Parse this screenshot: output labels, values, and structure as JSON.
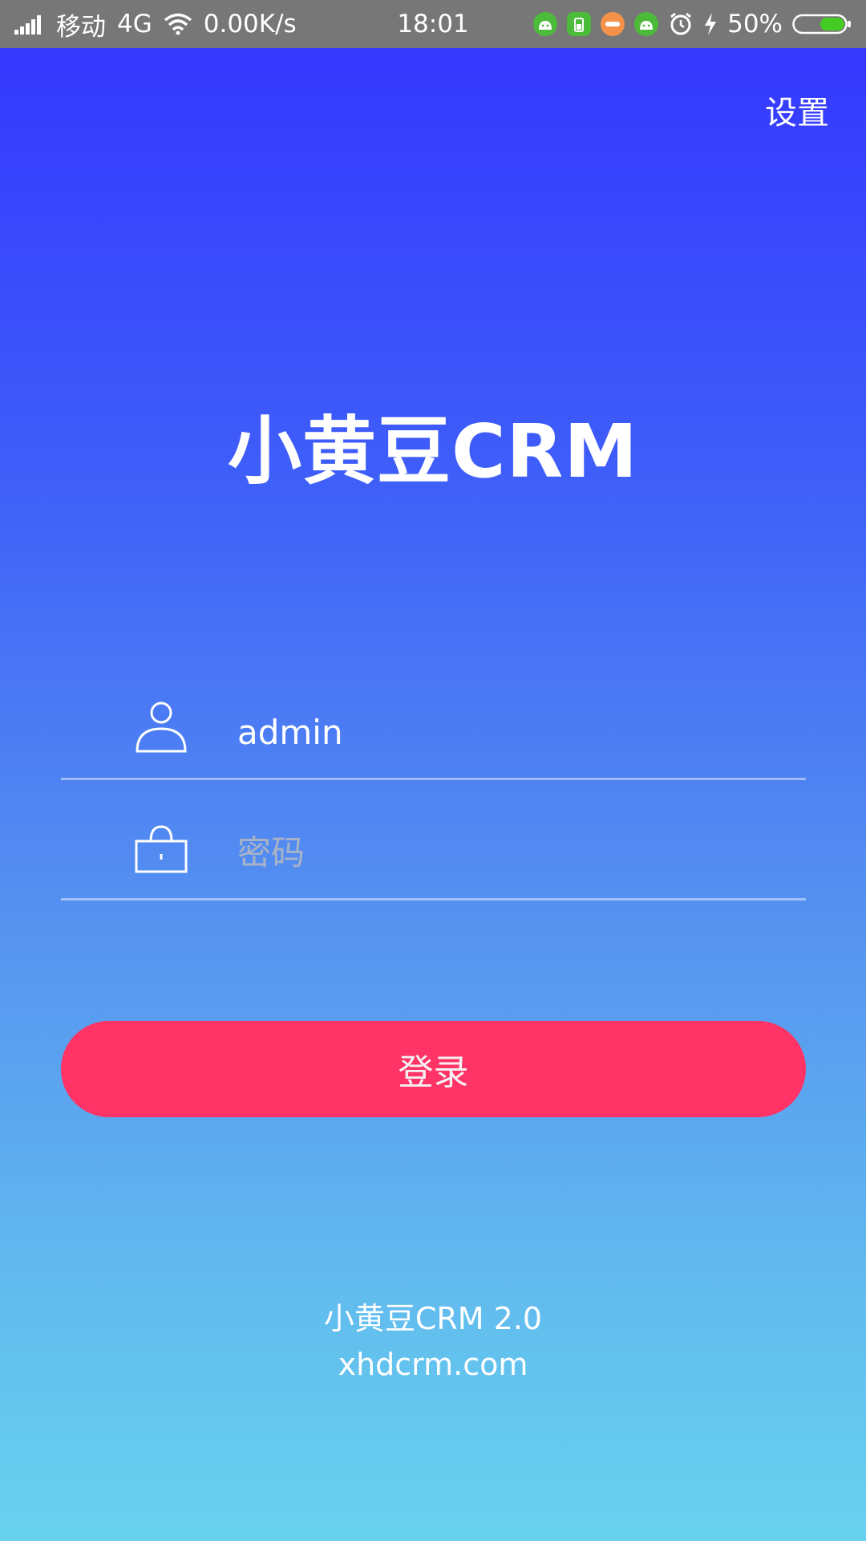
{
  "status_bar": {
    "carrier": "移动",
    "network": "4G",
    "speed": "0.00K/s",
    "time": "18:01",
    "battery_percent": "50%",
    "battery_level": 0.5,
    "icons": [
      "signal-icon",
      "wifi-icon",
      "android-app-icon",
      "battery-saver-icon",
      "orange-app-icon",
      "android-app-icon",
      "alarm-icon",
      "charging-bolt-icon",
      "battery-icon"
    ]
  },
  "header": {
    "settings_label": "设置"
  },
  "app": {
    "title": "小黄豆CRM"
  },
  "form": {
    "username_value": "admin",
    "username_placeholder": "",
    "password_value": "",
    "password_placeholder": "密码",
    "login_label": "登录"
  },
  "footer": {
    "version": "小黄豆CRM 2.0",
    "website": "xhdcrm.com"
  },
  "colors": {
    "gradient_top": "#3434FF",
    "gradient_bottom": "#68D2EE",
    "button": "#FF3366",
    "status_bar": "#777777"
  }
}
